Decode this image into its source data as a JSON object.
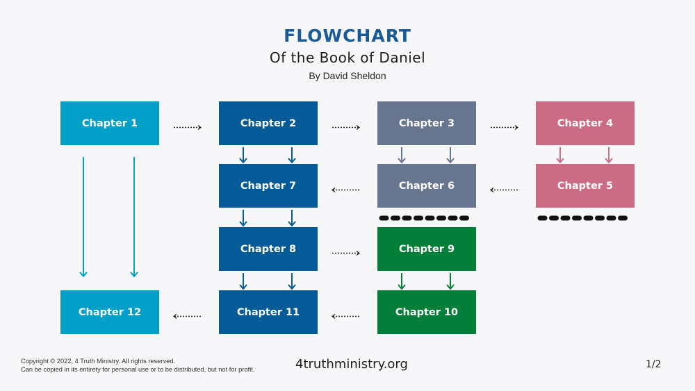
{
  "header": {
    "title": "FLOWCHART",
    "subtitle": "Of the Book of Daniel",
    "author": "By David Sheldon"
  },
  "colors": {
    "cyan": "#029fc8",
    "blue": "#055a98",
    "slate": "#67768e",
    "rose": "#cb6c84",
    "green": "#047f3a",
    "connector": "#1e1e1e"
  },
  "chapters": {
    "ch1": "Chapter 1",
    "ch2": "Chapter 2",
    "ch3": "Chapter 3",
    "ch4": "Chapter 4",
    "ch5": "Chapter 5",
    "ch6": "Chapter 6",
    "ch7": "Chapter 7",
    "ch8": "Chapter 8",
    "ch9": "Chapter 9",
    "ch10": "Chapter 10",
    "ch11": "Chapter 11",
    "ch12": "Chapter 12"
  },
  "flow": [
    {
      "from": "ch1",
      "to": "ch2",
      "style": "dotted"
    },
    {
      "from": "ch2",
      "to": "ch3",
      "style": "dotted"
    },
    {
      "from": "ch3",
      "to": "ch4",
      "style": "dotted"
    },
    {
      "from": "ch4",
      "to": "ch5",
      "style": "double-solid"
    },
    {
      "from": "ch5",
      "to": "ch6",
      "style": "dotted"
    },
    {
      "from": "ch3",
      "to": "ch6",
      "style": "double-solid"
    },
    {
      "from": "ch6",
      "to": "ch7",
      "style": "dotted"
    },
    {
      "from": "ch2",
      "to": "ch7",
      "style": "double-solid"
    },
    {
      "from": "ch7",
      "to": "ch8",
      "style": "double-solid"
    },
    {
      "from": "ch8",
      "to": "ch9",
      "style": "dotted"
    },
    {
      "from": "ch9",
      "to": "ch10",
      "style": "double-solid"
    },
    {
      "from": "ch10",
      "to": "ch11",
      "style": "dotted"
    },
    {
      "from": "ch8",
      "to": "ch11",
      "style": "double-solid"
    },
    {
      "from": "ch11",
      "to": "ch12",
      "style": "dotted"
    },
    {
      "from": "ch1",
      "to": "ch12",
      "style": "double-solid"
    }
  ],
  "footer": {
    "copyright_line1": "Copyright © 2022, 4 Truth Ministry. All rights reserved.",
    "copyright_line2": "Can be copied in its entirety for personal use or to be distributed, but not for profit.",
    "website": "4truthministry.org",
    "page": "1/2"
  }
}
